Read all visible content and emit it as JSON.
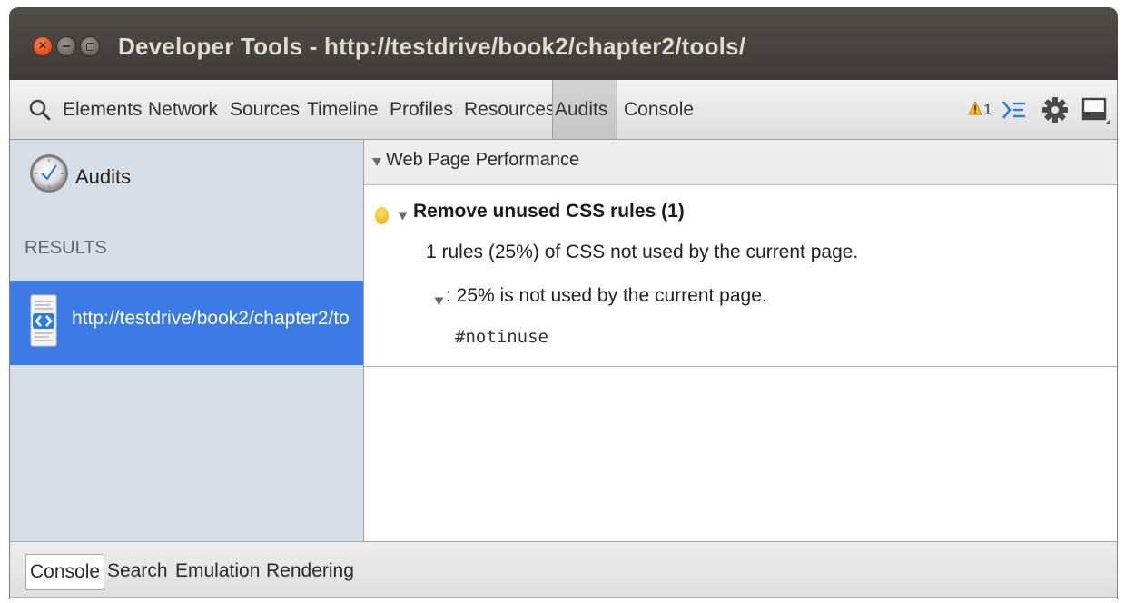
{
  "window": {
    "title": "Developer Tools - http://testdrive/book2/chapter2/tools/",
    "close_glyph": "×"
  },
  "toolbar": {
    "tabs": [
      {
        "label": "Elements"
      },
      {
        "label": "Network"
      },
      {
        "label": "Sources"
      },
      {
        "label": "Timeline"
      },
      {
        "label": "Profiles"
      },
      {
        "label": "Resources"
      },
      {
        "label": "Audits",
        "selected": true
      },
      {
        "label": "Console"
      }
    ],
    "warning_count": "1",
    "icons": [
      "search-icon",
      "warning-icon",
      "console-drawer-icon",
      "gear-icon",
      "dock-icon"
    ]
  },
  "sidebar": {
    "title": "Audits",
    "results_header": "RESULTS",
    "result_item": "http://testdrive/book2/chapter2/to",
    "selected_bg": "#3b7be6"
  },
  "main": {
    "section_title": "Web Page Performance",
    "rule_title": "Remove unused CSS rules (1)",
    "rule_description": "1 rules (25%) of CSS not used by the current page.",
    "detail": ": 25% is not used by the current page.",
    "selector": "#notinuse"
  },
  "drawer": {
    "tabs": [
      {
        "label": "Console",
        "selected": true
      },
      {
        "label": "Search"
      },
      {
        "label": "Emulation"
      },
      {
        "label": "Rendering"
      }
    ]
  },
  "colors": {
    "titlebar": "#45433f",
    "close_button": "#e8551f",
    "warning": "#f2b11c",
    "selection": "#3b7be6"
  }
}
